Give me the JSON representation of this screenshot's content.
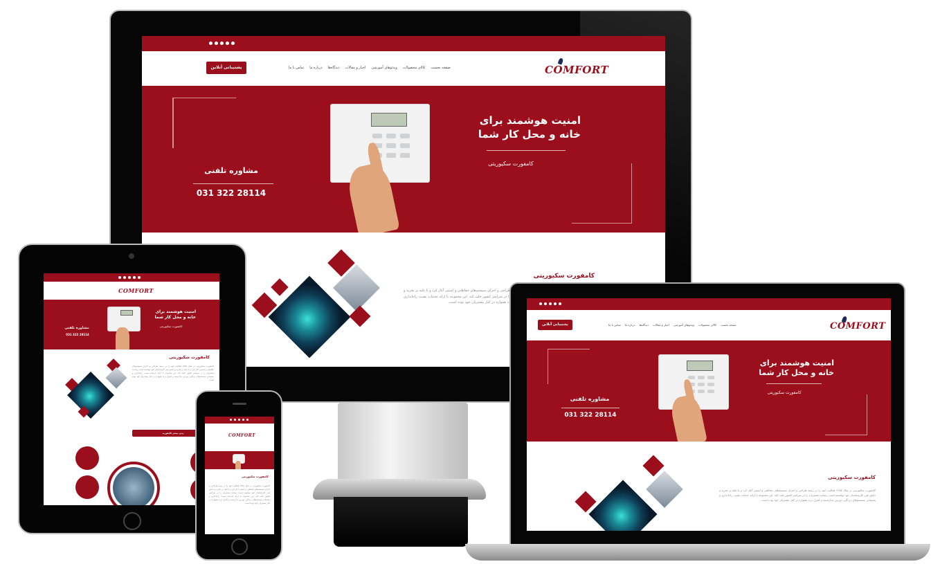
{
  "site": {
    "logo_text": "COMFORT",
    "menu": [
      "صفحه نخست",
      "کالای محصولات",
      "ویدئوهای آموزشی",
      "اخبار و مقالات",
      "دیدگاه‌ها",
      "درباره ما",
      "تماس با ما"
    ],
    "cta_label": "پشتیبانی آنلاین",
    "hero_title_line1": "امنیت هوشمند برای",
    "hero_title_line2": "خانه و محل کار شما",
    "hero_subtitle": "کامفورت سکیوریتی",
    "phone_label": "مشاوره تلفنی",
    "phone_number": "031 322 28114",
    "section_title": "کامفورت سکیوریتی",
    "section_text": "کامفورت سکیوریتی در سال ۱۳۸۵ فعالیت خود را در زمینه طراحی و اجرای سیستم‌های حفاظتی و امنیتی آغاز کرد و با تکیه بر تجربه و دانش فنی کارشناسان خود توانسته است رضایت مشتریان را در سراسر کشور جلب کند. این مجموعه با ارائه خدمات نصب، راه‌اندازی و پشتیبانی سیستم‌های دزدگیر، دوربین مداربسته و کنترل تردد همواره در کنار مشتریان خود بوده است.",
    "tablet_more_button": "دیدن بیشتر کامفورت"
  },
  "colors": {
    "brand_red": "#9b0e1c",
    "teal": "#2ed3c9",
    "device_black": "#050505"
  },
  "icons": [
    "facebook-icon",
    "twitter-icon",
    "google-icon",
    "youtube-icon",
    "instagram-icon"
  ]
}
